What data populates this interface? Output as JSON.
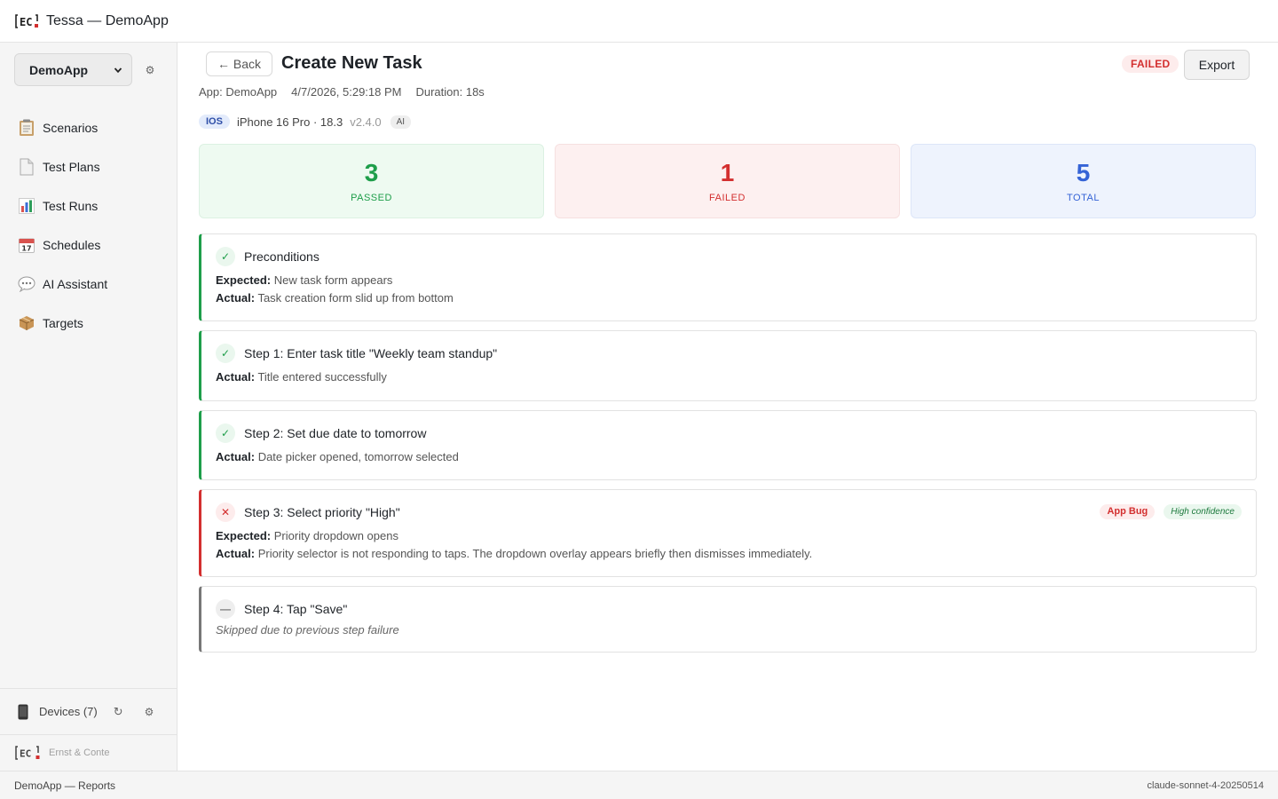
{
  "topbar": {
    "title": "Tessa — DemoApp"
  },
  "sidebar": {
    "app_select": "DemoApp",
    "items": [
      {
        "label": "Scenarios",
        "icon": "clipboard-icon"
      },
      {
        "label": "Test Plans",
        "icon": "document-icon"
      },
      {
        "label": "Test Runs",
        "icon": "bar-chart-icon"
      },
      {
        "label": "Schedules",
        "icon": "calendar-icon"
      },
      {
        "label": "AI Assistant",
        "icon": "speech-bubble-icon"
      },
      {
        "label": "Targets",
        "icon": "package-icon"
      }
    ],
    "devices_label": "Devices (7)",
    "footer_brand": "Ernst & Conte"
  },
  "header": {
    "back_label": "← Back",
    "title": "Create New Task",
    "status": "FAILED",
    "export_label": "Export",
    "app": "App: DemoApp",
    "datetime": "4/7/2026, 5:29:18 PM",
    "duration": "Duration: 18s",
    "platform": "IOS",
    "device": "iPhone 16 Pro · 18.3",
    "version": "v2.4.0",
    "ai_tag": "AI"
  },
  "stats": [
    {
      "value": "3",
      "label": "PASSED",
      "color": "#1e9e4a"
    },
    {
      "value": "1",
      "label": "FAILED",
      "color": "#d32f2f"
    },
    {
      "value": "5",
      "label": "TOTAL",
      "color": "#3563d6"
    }
  ],
  "labels": {
    "expected": "Expected:",
    "actual": "Actual:"
  },
  "steps": [
    {
      "status": "pass",
      "title": "Preconditions",
      "expected": "New task form appears",
      "actual": "Task creation form slid up from bottom"
    },
    {
      "status": "pass",
      "title": "Step 1: Enter task title \"Weekly team standup\"",
      "actual": "Title entered successfully"
    },
    {
      "status": "pass",
      "title": "Step 2: Set due date to tomorrow",
      "actual": "Date picker opened, tomorrow selected"
    },
    {
      "status": "fail",
      "title": "Step 3: Select priority \"High\"",
      "expected": "Priority dropdown opens",
      "actual": "Priority selector is not responding to taps. The dropdown overlay appears briefly then dismisses immediately.",
      "bug_badge": "App Bug",
      "confidence": "High confidence"
    },
    {
      "status": "skip",
      "title": "Step 4: Tap \"Save\"",
      "note": "Skipped due to previous step failure"
    }
  ],
  "statusbar": {
    "left": "DemoApp — Reports",
    "right": "claude-sonnet-4-20250514"
  },
  "colors": {
    "pass": "#1e9e4a",
    "fail": "#d32f2f",
    "total": "#3563d6"
  }
}
